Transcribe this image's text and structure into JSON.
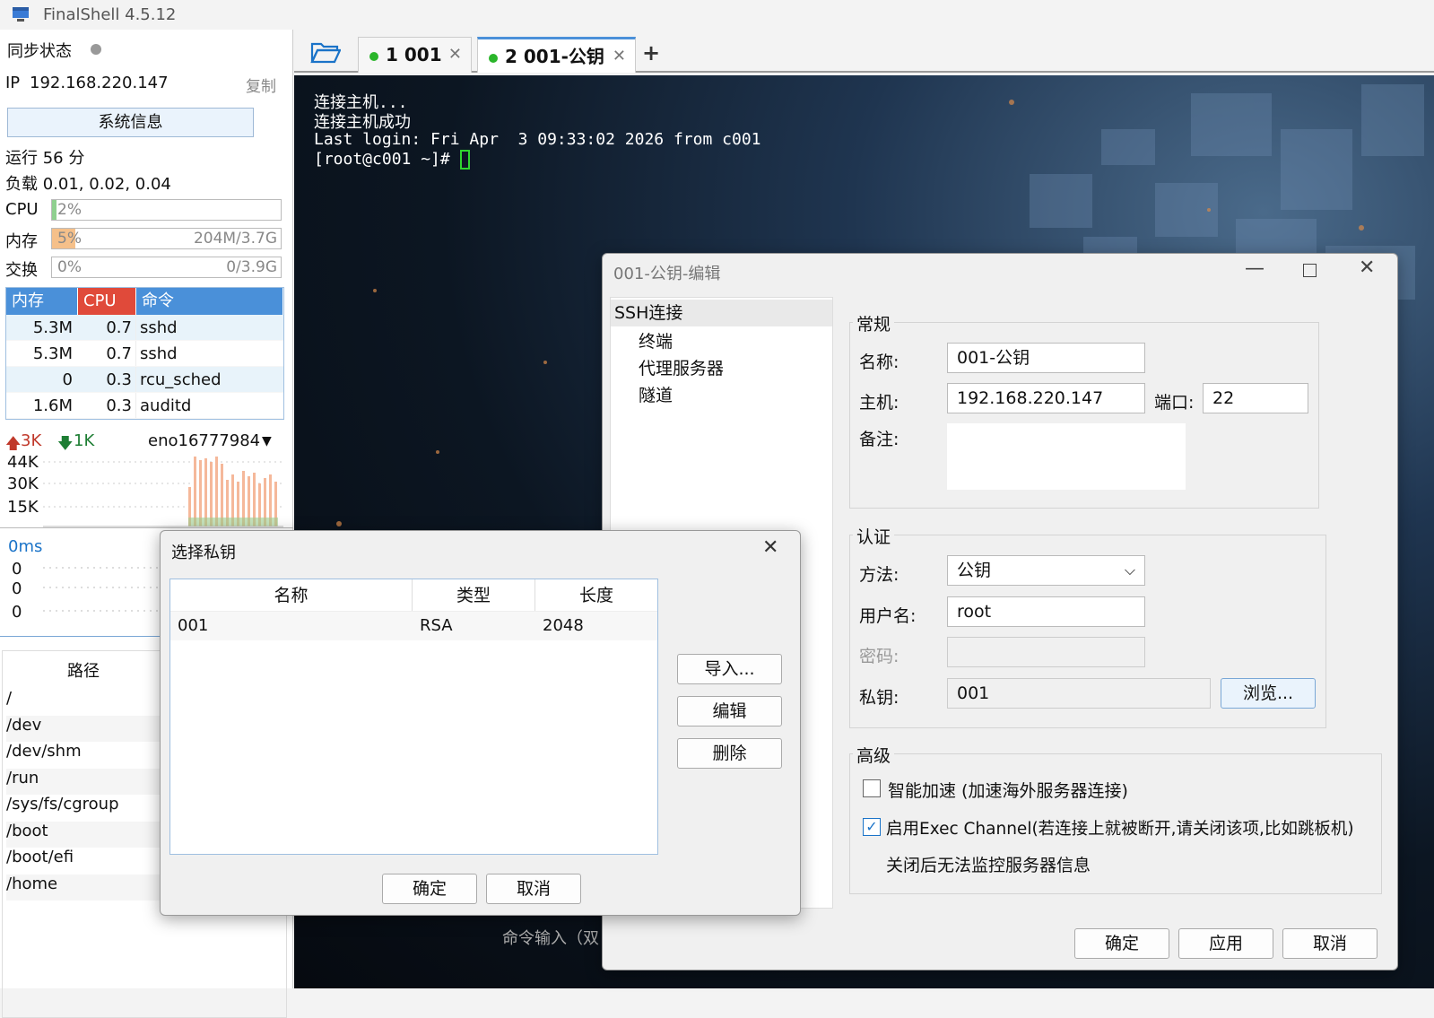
{
  "app": {
    "title": "FinalShell 4.5.12"
  },
  "left": {
    "sync_label": "同步状态",
    "ip_label": "IP",
    "ip": "192.168.220.147",
    "copy": "复制",
    "sysinfo_button": "系统信息",
    "uptime": "运行 56 分",
    "load": "负载 0.01, 0.02, 0.04",
    "cpu_label": "CPU",
    "cpu_value": "2%",
    "cpu_fraction": 0.02,
    "mem_label": "内存",
    "mem_value": "5%",
    "mem_detail": "204M/3.7G",
    "mem_fraction": 0.05,
    "swap_label": "交换",
    "swap_value": "0%",
    "swap_detail": "0/3.9G",
    "proc_headers": [
      "内存",
      "CPU",
      "命令"
    ],
    "processes": [
      {
        "mem": "5.3M",
        "cpu": "0.7",
        "cmd": "sshd"
      },
      {
        "mem": "5.3M",
        "cpu": "0.7",
        "cmd": "sshd"
      },
      {
        "mem": "0",
        "cpu": "0.3",
        "cmd": "rcu_sched"
      },
      {
        "mem": "1.6M",
        "cpu": "0.3",
        "cmd": "auditd"
      }
    ],
    "net_up": "3K",
    "net_down": "1K",
    "interface": "eno16777984",
    "net_axis": [
      "44K",
      "30K",
      "15K"
    ],
    "latency": "0ms",
    "latency_axis": [
      "0",
      "0",
      "0"
    ],
    "path_header": "路径",
    "paths": [
      "/",
      "/dev",
      "/dev/shm",
      "/run",
      "/sys/fs/cgroup",
      "/boot",
      "/boot/efi",
      "/home"
    ]
  },
  "tabs": [
    {
      "label": "1 001"
    },
    {
      "label": "2 001-公钥"
    }
  ],
  "terminal": {
    "lines": [
      "连接主机...",
      "连接主机成功",
      "Last login: Fri Apr  3 09:33:02 2026 from c001"
    ],
    "prompt": "[root@c001 ~]# ",
    "cmd_input": "命令输入（双"
  },
  "edit_dialog": {
    "title": "001-公钥-编辑",
    "tree": [
      "SSH连接",
      "终端",
      "代理服务器",
      "隧道"
    ],
    "general_title": "常规",
    "name_label": "名称:",
    "name_value": "001-公钥",
    "host_label": "主机:",
    "host_value": "192.168.220.147",
    "port_label": "端口:",
    "port_value": "22",
    "note_label": "备注:",
    "auth_title": "认证",
    "method_label": "方法:",
    "method_value": "公钥",
    "user_label": "用户名:",
    "user_value": "root",
    "password_label": "密码:",
    "key_label": "私钥:",
    "key_value": "001",
    "browse": "浏览...",
    "advanced_title": "高级",
    "smart_accel": "智能加速 (加速海外服务器连接)",
    "exec_channel": "启用Exec Channel(若连接上就被断开,请关闭该项,比如跳板机)",
    "exec_note": "关闭后无法监控服务器信息",
    "ok": "确定",
    "apply": "应用",
    "cancel": "取消"
  },
  "key_dialog": {
    "title": "选择私钥",
    "headers": [
      "名称",
      "类型",
      "长度"
    ],
    "rows": [
      {
        "name": "001",
        "type": "RSA",
        "length": "2048"
      }
    ],
    "import": "导入...",
    "edit": "编辑",
    "delete": "删除",
    "ok": "确定",
    "cancel": "取消"
  }
}
